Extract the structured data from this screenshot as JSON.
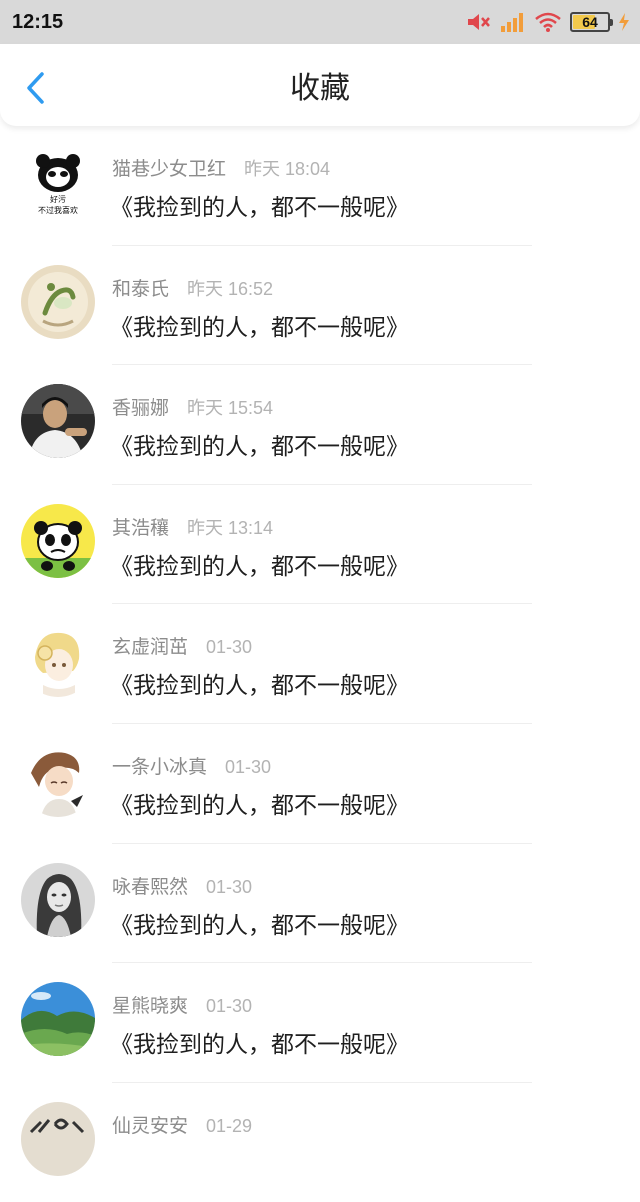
{
  "status_bar": {
    "time": "12:15",
    "battery_level": "64",
    "icons": [
      "muted-speaker-icon",
      "signal-icon",
      "wifi-icon",
      "battery-icon",
      "charging-bolt-icon"
    ]
  },
  "header": {
    "title": "收藏",
    "back_icon": "chevron-left-icon"
  },
  "colors": {
    "accent": "#2f9bf0",
    "status_bar_bg": "#d9d9d9",
    "name_text": "#8c8c8c",
    "time_text": "#b3b3b3"
  },
  "items": [
    {
      "name": "猫巷少女卫红",
      "time": "昨天 18:04",
      "message": "《我捡到的人，都不一般呢》",
      "avatar_text": "好污\n不过我喜欢"
    },
    {
      "name": "和泰氏",
      "time": "昨天 16:52",
      "message": "《我捡到的人，都不一般呢》"
    },
    {
      "name": "香骊娜",
      "time": "昨天 15:54",
      "message": "《我捡到的人，都不一般呢》"
    },
    {
      "name": "其浩穰",
      "time": "昨天 13:14",
      "message": "《我捡到的人，都不一般呢》"
    },
    {
      "name": "玄虚润茁",
      "time": "01-30",
      "message": "《我捡到的人，都不一般呢》"
    },
    {
      "name": "一条小冰真",
      "time": "01-30",
      "message": "《我捡到的人，都不一般呢》"
    },
    {
      "name": "咏春熙然",
      "time": "01-30",
      "message": "《我捡到的人，都不一般呢》"
    },
    {
      "name": "星熊晓爽",
      "time": "01-30",
      "message": "《我捡到的人，都不一般呢》"
    },
    {
      "name": "仙灵安安",
      "time": "01-29",
      "message": ""
    }
  ]
}
